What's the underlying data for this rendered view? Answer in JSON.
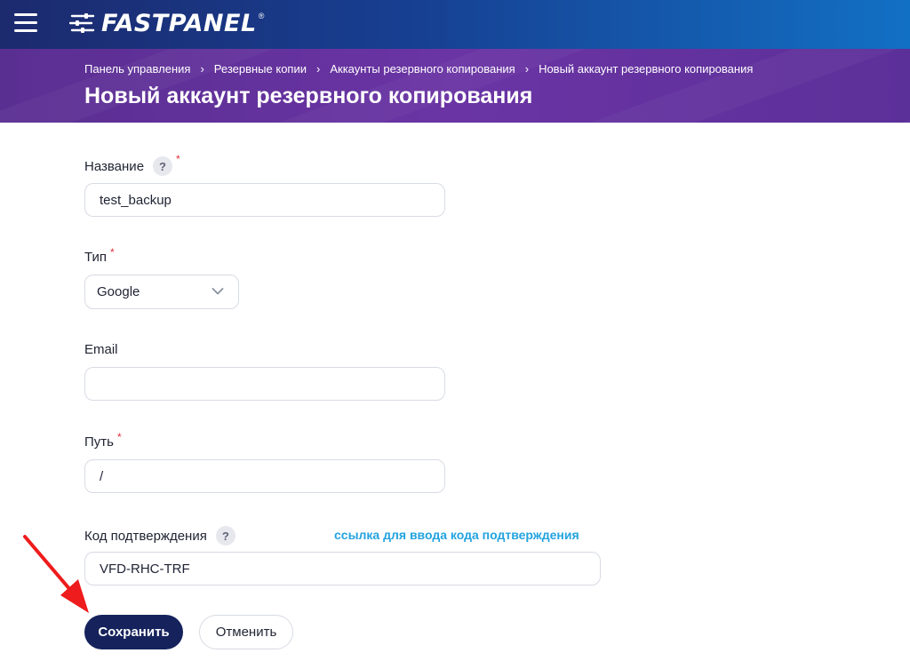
{
  "topbar": {
    "logo_text": "FASTPANEL",
    "logo_reg": "®",
    "menu_icon": "hamburger-menu-icon"
  },
  "breadcrumb": [
    {
      "label": "Панель управления"
    },
    {
      "label": "Резервные копии"
    },
    {
      "label": "Аккаунты резервного копирования"
    },
    {
      "label": "Новый аккаунт резервного копирования"
    }
  ],
  "breadcrumb_separator": "›",
  "page_title": "Новый аккаунт резервного копирования",
  "form": {
    "name": {
      "label": "Название",
      "help": "?",
      "required_mark": "*",
      "value": "test_backup"
    },
    "type": {
      "label": "Тип",
      "required_mark": "*",
      "value": "Google"
    },
    "email": {
      "label": "Email",
      "value": ""
    },
    "path": {
      "label": "Путь",
      "required_mark": "*",
      "value": "/"
    },
    "code": {
      "label": "Код подтверждения",
      "help": "?",
      "value": "VFD-RHC-TRF",
      "link": "ссылка для ввода кода подтверждения"
    }
  },
  "buttons": {
    "save": "Сохранить",
    "cancel": "Отменить"
  },
  "colors": {
    "topbar": "#173f91",
    "header": "#6a34a4",
    "save_button": "#16225c",
    "link": "#23a3e0",
    "required": "#e0303a",
    "annotation_arrow": "#ee1c1c"
  }
}
